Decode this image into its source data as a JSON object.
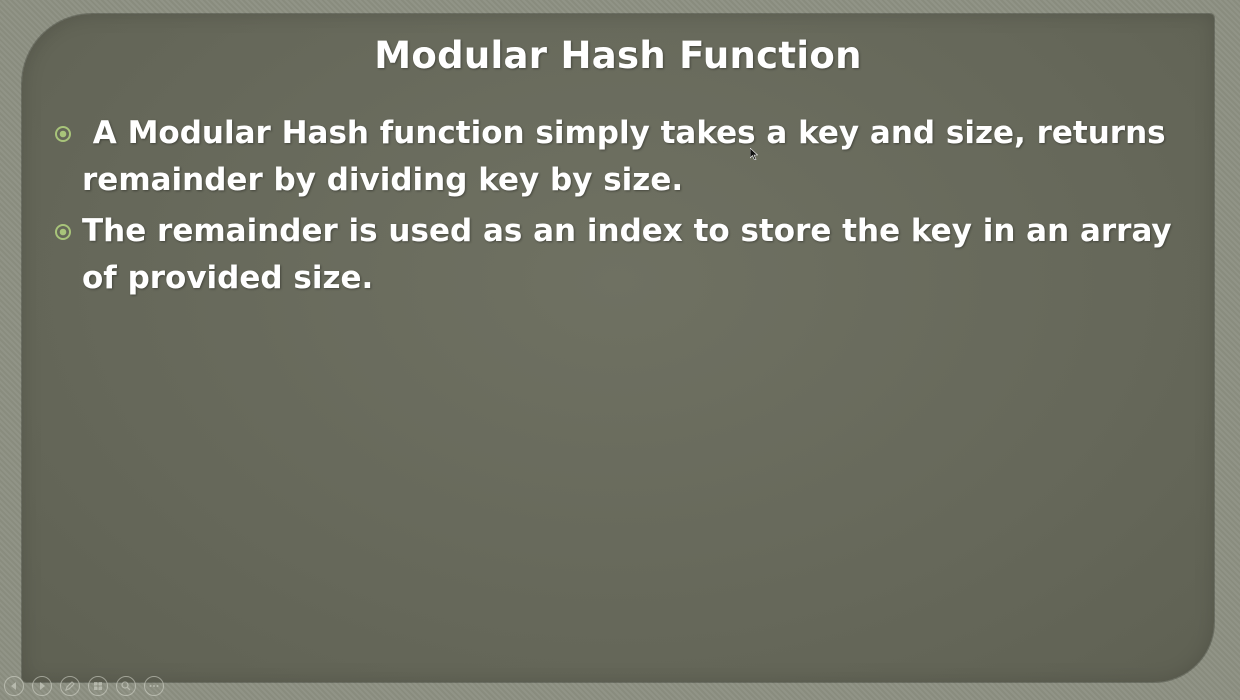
{
  "slide": {
    "title": "Modular Hash Function",
    "bullets": [
      {
        "text": " A Modular Hash function simply takes a key and size, returns remainder by dividing key by size."
      },
      {
        "text": "The remainder is used as an index to store the key in an array of provided size."
      }
    ]
  },
  "controls": [
    {
      "icon": "previous-icon"
    },
    {
      "icon": "next-icon"
    },
    {
      "icon": "pen-icon"
    },
    {
      "icon": "slides-grid-icon"
    },
    {
      "icon": "zoom-icon"
    },
    {
      "icon": "more-icon"
    }
  ],
  "colors": {
    "slide_background": "#66685a",
    "frame_background": "#8d9082",
    "text": "#ffffff",
    "bullet_accent": "#a8c47a"
  }
}
